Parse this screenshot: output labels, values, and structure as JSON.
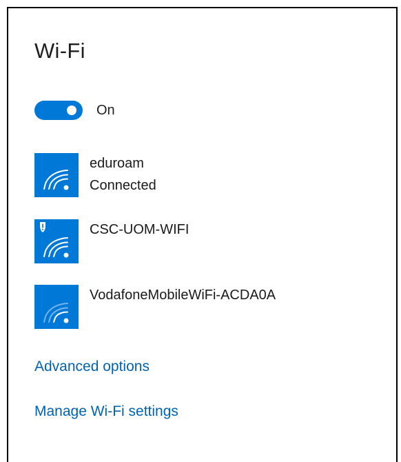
{
  "colors": {
    "accent": "#0078d7",
    "link": "#0063b1"
  },
  "wifi": {
    "title": "Wi-Fi",
    "toggle_state": "On"
  },
  "networks": [
    {
      "name": "eduroam",
      "status": "Connected",
      "icon": "wifi-signal-icon",
      "secured_badge": false
    },
    {
      "name": "CSC-UOM-WIFI",
      "status": "",
      "icon": "wifi-signal-icon",
      "secured_badge": true,
      "badge_icon": "shield-icon"
    },
    {
      "name": "VodafoneMobileWiFi-ACDA0A",
      "status": "",
      "icon": "wifi-signal-icon",
      "secured_badge": false
    }
  ],
  "links": {
    "advanced": "Advanced options",
    "manage": "Manage Wi-Fi settings"
  }
}
